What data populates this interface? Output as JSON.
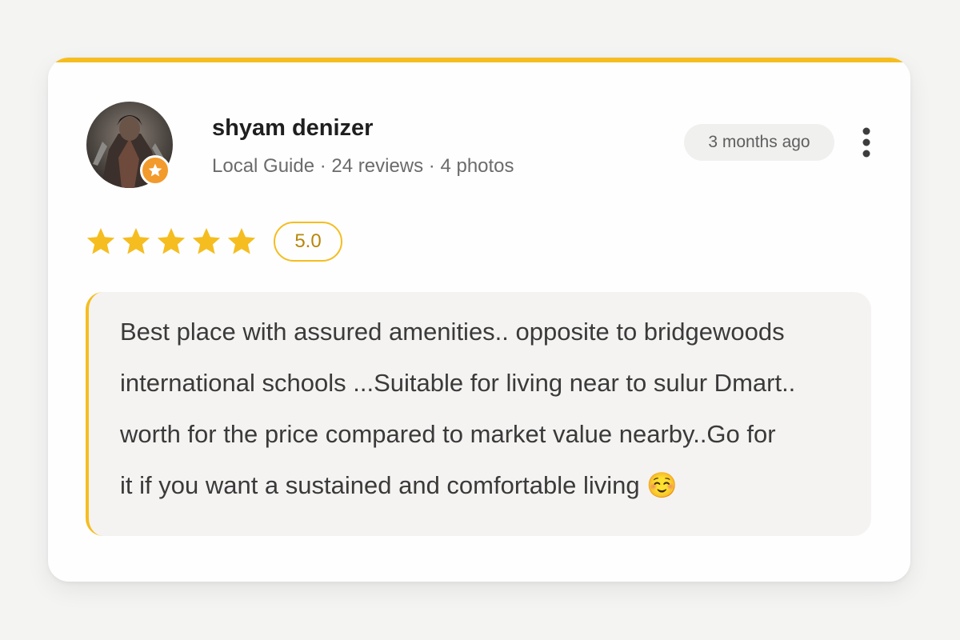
{
  "review": {
    "author_name": "shyam denizer",
    "author_meta": "Local Guide · 24 reviews · 4 photos",
    "time_ago": "3 months ago",
    "rating_value": "5.0",
    "rating_stars": 5,
    "text": "Best place with assured amenities.. opposite to bridgewoods\ninternational schools ...Suitable for living near to sulur  Dmart..\nworth for the price compared to market value nearby..Go for\nit if you want a sustained and comfortable living ☺️"
  },
  "colors": {
    "accent": "#f5bd1f",
    "badge": "#f39a2c",
    "star": "#f5bd1f"
  },
  "icons": {
    "avatar_badge": "star-icon",
    "menu": "more-vertical-icon"
  }
}
